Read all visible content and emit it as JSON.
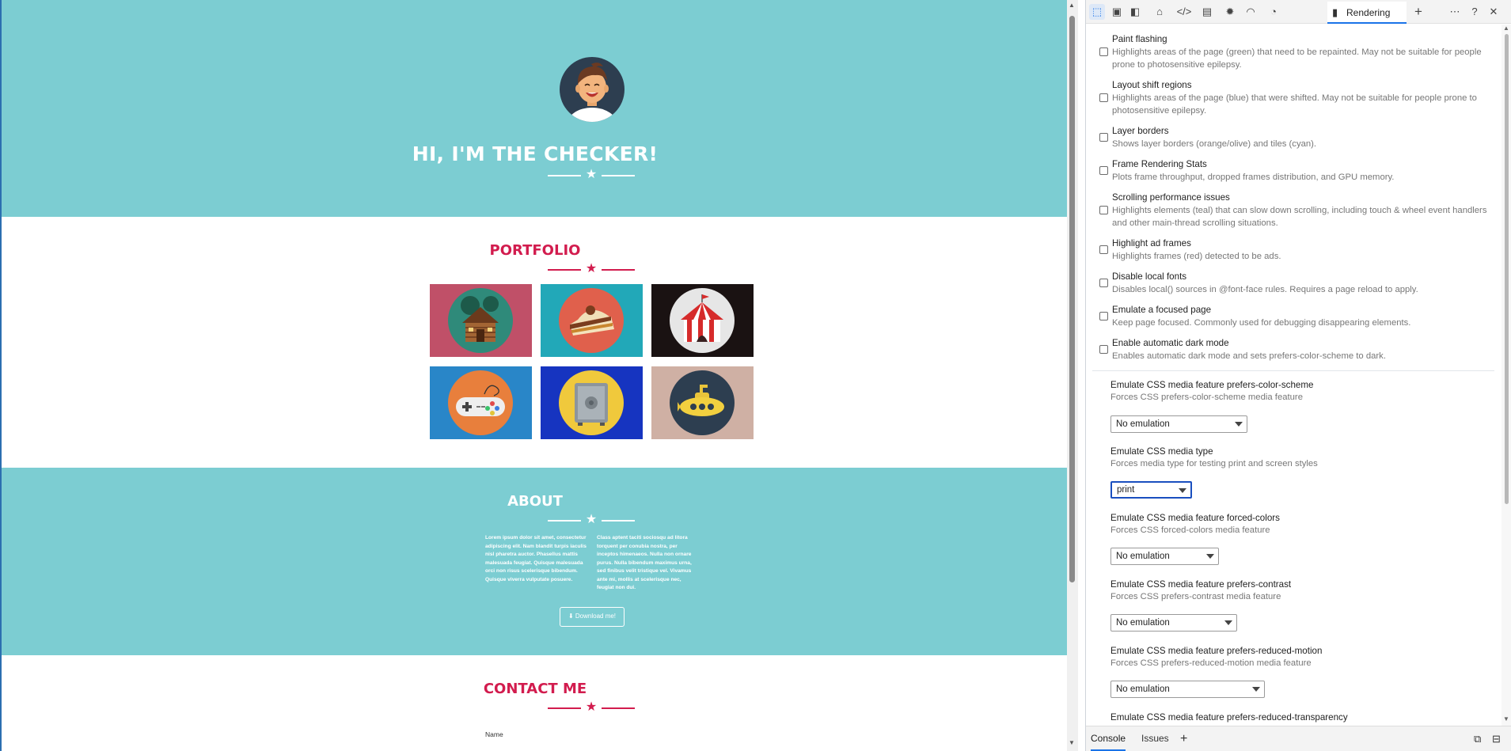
{
  "site": {
    "hero": {
      "title": "HI, I'M THE CHECKER!",
      "bg": "#7ccdd2"
    },
    "portfolio": {
      "title": "PORTFOLIO",
      "accent": "#d21c4e",
      "items": [
        {
          "name": "cabin",
          "bg": "#c05068",
          "circle": "#2f8a7a",
          "icon": "cabin-icon"
        },
        {
          "name": "cake",
          "bg": "#22a8b8",
          "circle": "#e0604c",
          "icon": "cake-icon"
        },
        {
          "name": "circus",
          "bg": "#1a1212",
          "circle": "#e6e6e6",
          "icon": "circus-tent-icon"
        },
        {
          "name": "game",
          "bg": "#2986c8",
          "circle": "#e87f3c",
          "icon": "gamepad-icon"
        },
        {
          "name": "safe",
          "bg": "#1634c0",
          "circle": "#f0c93c",
          "icon": "safe-icon"
        },
        {
          "name": "submarine",
          "bg": "#cfb0a4",
          "circle": "#2d3e50",
          "icon": "submarine-icon"
        }
      ]
    },
    "about": {
      "title": "ABOUT",
      "col1": "Lorem ipsum dolor sit amet, consectetur adipiscing elit. Nam blandit turpis iaculis nisl pharetra auctor. Phasellus mattis malesuada feugiat. Quisque malesuada orci non risus scelerisque bibendum. Quisque viverra vulputate posuere.",
      "col2": "Class aptent taciti sociosqu ad litora torquent per conubia nostra, per inceptos himenaeos. Nulla non ornare purus. Nulla bibendum maximus urna, sed finibus velit tristique vel. Vivamus ante mi, mollis at scelerisque nec, feugiat non dui.",
      "download_label": "Download me!"
    },
    "contact": {
      "title": "CONTACT ME",
      "name_label": "Name"
    }
  },
  "devtools": {
    "active_tab": "Rendering",
    "toolbar_icons": [
      "inspect-icon",
      "device-toggle-icon",
      "dock-icon",
      "home-icon",
      "elements-icon",
      "console-icon",
      "bug-icon",
      "network-icon",
      "performance-icon",
      "rendering-icon",
      "plus-icon",
      "more-icon",
      "help-icon",
      "close-icon"
    ],
    "options": [
      {
        "title": "Paint flashing",
        "desc": "Highlights areas of the page (green) that need to be repainted. May not be suitable for people prone to photosensitive epilepsy.",
        "checked": false
      },
      {
        "title": "Layout shift regions",
        "desc": "Highlights areas of the page (blue) that were shifted. May not be suitable for people prone to photosensitive epilepsy.",
        "checked": false
      },
      {
        "title": "Layer borders",
        "desc": "Shows layer borders (orange/olive) and tiles (cyan).",
        "checked": false
      },
      {
        "title": "Frame Rendering Stats",
        "desc": "Plots frame throughput, dropped frames distribution, and GPU memory.",
        "checked": false
      },
      {
        "title": "Scrolling performance issues",
        "desc": "Highlights elements (teal) that can slow down scrolling, including touch & wheel event handlers and other main-thread scrolling situations.",
        "checked": false
      },
      {
        "title": "Highlight ad frames",
        "desc": "Highlights frames (red) detected to be ads.",
        "checked": false
      },
      {
        "title": "Disable local fonts",
        "desc": "Disables local() sources in @font-face rules. Requires a page reload to apply.",
        "checked": false
      },
      {
        "title": "Emulate a focused page",
        "desc": "Keep page focused. Commonly used for debugging disappearing elements.",
        "checked": false
      },
      {
        "title": "Enable automatic dark mode",
        "desc": "Enables automatic dark mode and sets prefers-color-scheme to dark.",
        "checked": false
      }
    ],
    "emulations": [
      {
        "title": "Emulate CSS media feature prefers-color-scheme",
        "desc": "Forces CSS prefers-color-scheme media feature",
        "value": "No emulation"
      },
      {
        "title": "Emulate CSS media type",
        "desc": "Forces media type for testing print and screen styles",
        "value": "print"
      },
      {
        "title": "Emulate CSS media feature forced-colors",
        "desc": "Forces CSS forced-colors media feature",
        "value": "No emulation"
      },
      {
        "title": "Emulate CSS media feature prefers-contrast",
        "desc": "Forces CSS prefers-contrast media feature",
        "value": "No emulation"
      },
      {
        "title": "Emulate CSS media feature prefers-reduced-motion",
        "desc": "Forces CSS prefers-reduced-motion media feature",
        "value": "No emulation"
      },
      {
        "title": "Emulate CSS media feature prefers-reduced-transparency",
        "desc": "",
        "value": ""
      }
    ],
    "drawer": {
      "console": "Console",
      "issues": "Issues"
    }
  }
}
